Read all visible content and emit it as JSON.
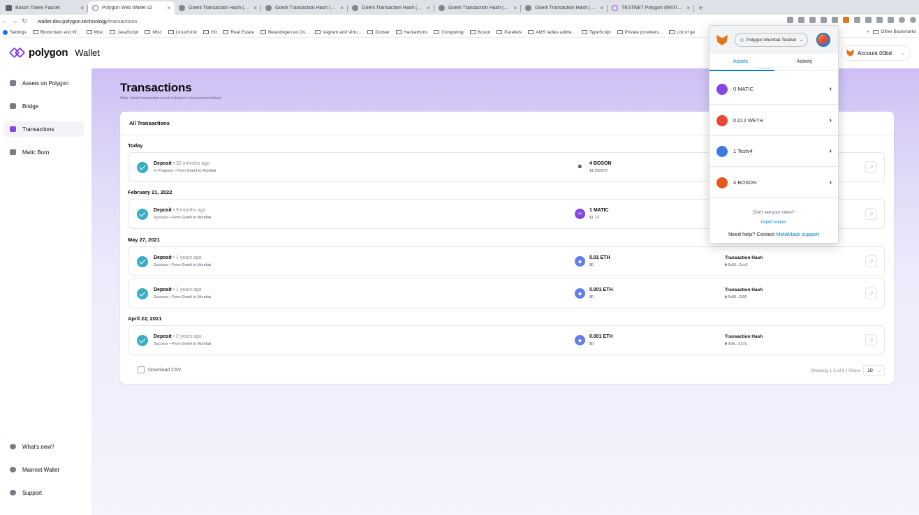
{
  "browser": {
    "tabs": [
      {
        "title": "Boson Token Faucet",
        "icon": "page-icon",
        "active": false
      },
      {
        "title": "Polygon Web Wallet v2",
        "icon": "polygon-icon",
        "active": true
      },
      {
        "title": "Goerli Transaction Hash (Txha...",
        "icon": "globe-icon",
        "active": false
      },
      {
        "title": "Goerli Transaction Hash (Txha...",
        "icon": "globe-icon",
        "active": false
      },
      {
        "title": "Goerli Transaction Hash (Txha...",
        "icon": "globe-icon",
        "active": false
      },
      {
        "title": "Goerli Transaction Hash (Txha...",
        "icon": "globe-icon",
        "active": false
      },
      {
        "title": "Goerli Transaction Hash (Txha...",
        "icon": "globe-icon",
        "active": false
      },
      {
        "title": "TESTNET Polygon (MATIC) Blo...",
        "icon": "polygon-icon",
        "active": false
      }
    ],
    "url_host": "wallet-dev.polygon.technology",
    "url_path": "/transactions",
    "bookmarks": [
      "Settings",
      "Blockchain and W...",
      "Misc",
      "JavaScript",
      "Misc",
      "Linux/Unix",
      "Git",
      "Real Estate",
      "Belastingen en Ov...",
      "Vagrant and Virtu...",
      "Docker",
      "Hackathons",
      "Computing",
      "Boson",
      "Parallels",
      "AMS ladies addre...",
      "TypeScript",
      "Private providers...",
      "List of ge"
    ],
    "bookmarks_right": [
      "»",
      "Other Bookmarks"
    ]
  },
  "app": {
    "logo_text": "polygon",
    "logo_sub": "Wallet",
    "account_label": "Account 00bd",
    "sidebar_top": [
      {
        "label": "Assets on Polygon",
        "icon": "wallet-icon",
        "active": false
      },
      {
        "label": "Bridge",
        "icon": "bridge-icon",
        "active": false
      },
      {
        "label": "Transactions",
        "icon": "transactions-icon",
        "active": true
      },
      {
        "label": "Matic Burn",
        "icon": "flame-icon",
        "active": false
      }
    ],
    "sidebar_bottom": [
      {
        "label": "What's new?",
        "icon": "arrow-up-icon"
      },
      {
        "label": "Mainnet Wallet",
        "icon": "wallet-icon"
      },
      {
        "label": "Support",
        "icon": "support-icon"
      }
    ]
  },
  "page": {
    "title": "Transactions",
    "note": "Note: Send transaction is not included in transaction history",
    "card_title": "All Transactions",
    "groups": [
      {
        "date": "Today",
        "rows": [
          {
            "type": "Deposit",
            "time": " • 32 minutes ago",
            "status": "In Progress • From Goerli to Mumbai",
            "token_icon": "B",
            "token": "boson",
            "amount": "4 BOSON",
            "usd": "$1.092872",
            "hash_label": "",
            "hash": ""
          }
        ]
      },
      {
        "date": "February 21, 2022",
        "rows": [
          {
            "type": "Deposit",
            "time": " • 9 months ago",
            "status": "Success • From Goerli to Mumbai",
            "token_icon": "∞",
            "token": "matic",
            "amount": "1 MATIC",
            "usd": "$1.12",
            "hash_label": "",
            "hash": ""
          }
        ]
      },
      {
        "date": "May 27, 2021",
        "rows": [
          {
            "type": "Deposit",
            "time": " • 1 years ago",
            "status": "Success • From Goerli to Mumbai",
            "token_icon": "◆",
            "token": "eth",
            "amount": "0.01 ETH",
            "usd": "$0",
            "hash_label": "Transaction Hash",
            "hash": "⧫ 0x56...2cc9"
          },
          {
            "type": "Deposit",
            "time": " • 1 years ago",
            "status": "Success • From Goerli to Mumbai",
            "token_icon": "◆",
            "token": "eth",
            "amount": "0.001 ETH",
            "usd": "$0",
            "hash_label": "Transaction Hash",
            "hash": "⧫ 0x00...f306"
          }
        ]
      },
      {
        "date": "April 22, 2021",
        "rows": [
          {
            "type": "Deposit",
            "time": " • 2 years ago",
            "status": "Success • From Goerli to Mumbai",
            "token_icon": "◆",
            "token": "eth",
            "amount": "0.001 ETH",
            "usd": "$0",
            "hash_label": "Transaction Hash",
            "hash": "⧫ 0xfe...317a"
          }
        ]
      }
    ],
    "download_label": "Download CSV",
    "pager_text": "Showing 1-5 of 5 | Show:",
    "page_size": "10"
  },
  "metamask": {
    "network": "Polygon Mumbai Testnet",
    "tabs": [
      "Assets",
      "Activity"
    ],
    "assets": [
      {
        "label": "0 MATIC",
        "color": "#8247e5"
      },
      {
        "label": "0.012 WETH",
        "color": "#e8483a"
      },
      {
        "label": "1 Testv4",
        "color": "#3d7be3"
      },
      {
        "label": "4 BOSON",
        "color": "#e2591b"
      }
    ],
    "dont_see": "Don't see your token?",
    "import_tokens": "Import tokens",
    "help_text": "Need help? Contact ",
    "help_link": "MetaMask support"
  },
  "colors": {
    "brand": "#8247e5",
    "check": "#37aec4",
    "metamask_link": "#037dd6"
  }
}
